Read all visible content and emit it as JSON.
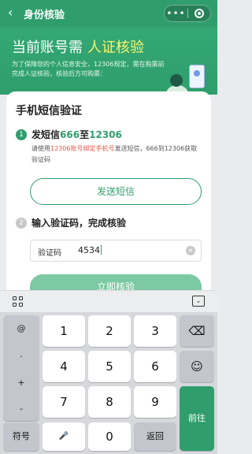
{
  "nav": {
    "back_glyph": "‹",
    "title": "身份核验",
    "more_glyph": "•••"
  },
  "banner": {
    "title_prefix": "当前账号需",
    "title_highlight": "人证核验",
    "desc": "为了保障您的个人信息安全，12306规定，需在购票前完成人证核验，核验后方可购票："
  },
  "card": {
    "title": "手机短信验证",
    "step1": {
      "num": "1",
      "title_pre": "发短信",
      "title_code": "666",
      "title_mid": "至",
      "title_number": "12306",
      "desc_pre": "请使用",
      "desc_red": "12306账号绑定手机号",
      "desc_post": "发送短信，666到12306获取验证码"
    },
    "send_button": "发送短信",
    "step2": {
      "num": "2",
      "title": "输入验证码，完成核验"
    },
    "code_label": "验证码",
    "code_value": "4534",
    "clear_glyph": "×",
    "verify_button": "立即核验"
  },
  "keyboard": {
    "hide_glyph": "⌄",
    "side": [
      "@",
      ".",
      "+",
      "-"
    ],
    "digits": [
      "1",
      "2",
      "3",
      "4",
      "5",
      "6",
      "7",
      "8",
      "9"
    ],
    "zero": "0",
    "symbols_label": "符号",
    "mic_glyph": "🎤",
    "return_label": "返回",
    "delete_glyph": "⌫",
    "emoji_glyph": "☺",
    "go_label": "前往"
  },
  "colors": {
    "brand": "#2f9e6c",
    "highlight": "#fff36a",
    "red_text": "#e25a4a"
  }
}
